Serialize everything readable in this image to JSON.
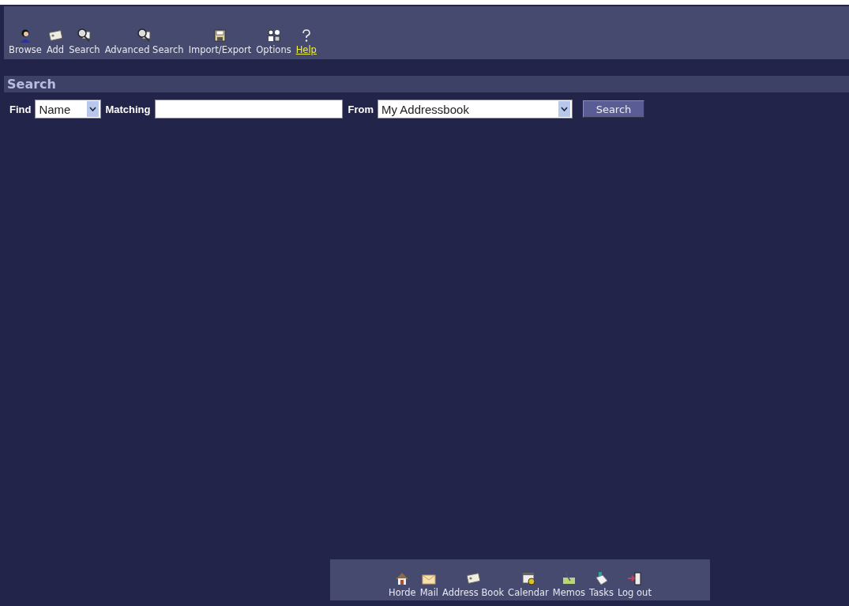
{
  "toolbar": [
    {
      "label": "Browse",
      "kind": "person",
      "link": false
    },
    {
      "label": "Add",
      "kind": "card",
      "link": false
    },
    {
      "label": "Search",
      "kind": "magnifier",
      "link": false
    },
    {
      "label": "Advanced Search",
      "kind": "magnifier",
      "link": false
    },
    {
      "label": "Import/Export",
      "kind": "disk",
      "link": false
    },
    {
      "label": "Options",
      "kind": "shapes",
      "link": false
    },
    {
      "label": "Help",
      "kind": "question",
      "link": true
    }
  ],
  "section_title": "Search",
  "search_form": {
    "find_label": "Find",
    "find_value": "Name",
    "matching_label": "Matching",
    "from_label": "From",
    "from_value": "My Addressbook",
    "button": "Search"
  },
  "apps": [
    {
      "label": "Horde",
      "kind": "house"
    },
    {
      "label": "Mail",
      "kind": "envelope"
    },
    {
      "label": "Address Book",
      "kind": "card"
    },
    {
      "label": "Calendar",
      "kind": "calendar"
    },
    {
      "label": "Memos",
      "kind": "note"
    },
    {
      "label": "Tasks",
      "kind": "paper"
    },
    {
      "label": "Log out",
      "kind": "door"
    }
  ]
}
